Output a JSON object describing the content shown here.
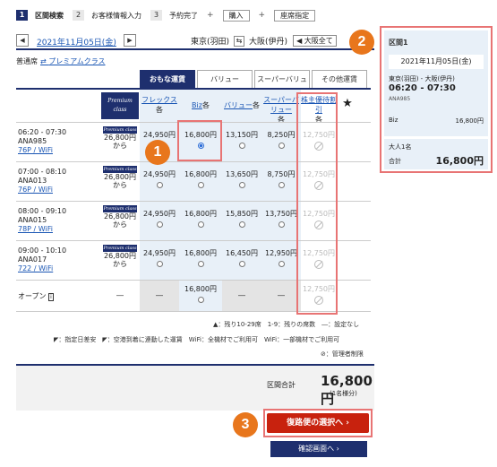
{
  "steps": [
    {
      "num": "1",
      "label": "区間検索"
    },
    {
      "num": "2",
      "label": "お客様情報入力"
    },
    {
      "num": "3",
      "label": "予約完了"
    }
  ],
  "step_actions": [
    "購入",
    "座席指定"
  ],
  "date_bar": {
    "date": "2021年11月05日(金)",
    "from": "東京(羽田)",
    "to": "大阪(伊丹)",
    "all_button": "大阪全て"
  },
  "fare_type": {
    "label": "普通席",
    "premium_link": "プレミアムクラス"
  },
  "tabs": [
    "おもな運賃",
    "バリュー",
    "スーパーバリュー",
    "その他運賃"
  ],
  "columns": {
    "premium": "Premium class",
    "flex": "フレックス",
    "biz": "Biz",
    "value": "バリュー",
    "super_value": "スーパーバリュー",
    "holder": "株主優待割引",
    "unit": "各",
    "star": "★"
  },
  "flights": [
    {
      "time": "06:20 - 07:30",
      "no": "ANA985",
      "eq": "76P / WiFi",
      "pc_price": "26,800円",
      "pc_from": "から",
      "flex": "24,950円",
      "biz": "16,800円",
      "value": "13,150円",
      "sv": "8,250円",
      "holder": "12,750円",
      "selected": "biz"
    },
    {
      "time": "07:00 - 08:10",
      "no": "ANA013",
      "eq": "76P / WiFi",
      "pc_price": "26,800円",
      "pc_from": "から",
      "flex": "24,950円",
      "biz": "16,800円",
      "value": "13,650円",
      "sv": "8,750円",
      "holder": "12,750円",
      "selected": ""
    },
    {
      "time": "08:00 - 09:10",
      "no": "ANA015",
      "eq": "78P / WiFi",
      "pc_price": "26,800円",
      "pc_from": "から",
      "flex": "24,950円",
      "biz": "16,800円",
      "value": "15,850円",
      "sv": "13,750円",
      "holder": "12,750円",
      "selected": ""
    },
    {
      "time": "09:00 - 10:10",
      "no": "ANA017",
      "eq": "722 / WiFi",
      "pc_price": "26,800円",
      "pc_from": "から",
      "flex": "24,950円",
      "biz": "16,800円",
      "value": "16,450円",
      "sv": "12,950円",
      "holder": "12,750円",
      "selected": ""
    }
  ],
  "open_row": {
    "label": "オープン",
    "pc": "―",
    "flex": "―",
    "biz": "16,800円",
    "value": "―",
    "sv": "―",
    "holder": "12,750円"
  },
  "legend": {
    "line1": "▲：残り10-29席　1-9：残りの席数　―：設定なし",
    "line2": "◤：指定日差安　◤：空港到着に連動した運賃　WiFi：全機材でご利用可　WiFi：一部機材でご利用可",
    "line3": "⊘：管理者制限"
  },
  "total": {
    "label": "区間合計",
    "price": "16,800円",
    "sub": "(1名様分)"
  },
  "buttons": {
    "return": "復路便の選択へ",
    "confirm": "確認画面へ"
  },
  "callouts": [
    "1",
    "2",
    "3"
  ],
  "panel": {
    "title": "区間1",
    "date": "2021年11月05日(金)",
    "route": "東京(羽田) - 大阪(伊丹)",
    "time": "06:20 - 07:30",
    "flight": "ANA985",
    "class": "Biz",
    "class_price": "16,800円",
    "pax": "大人1名",
    "total_label": "合計",
    "total": "16,800円"
  }
}
